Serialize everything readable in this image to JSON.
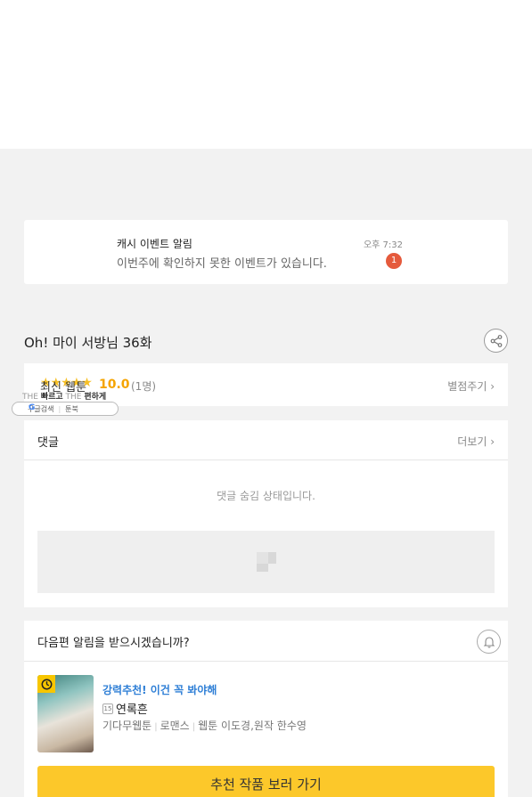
{
  "notification": {
    "title": "캐시 이벤트 알림",
    "message": "이번주에 확인하지 못한 이벤트가 있습니다.",
    "time": "오후 7:32",
    "badge_count": "1"
  },
  "episode": {
    "title": "Oh! 마이 서방님 36화"
  },
  "rating": {
    "label": "최신 웹툰",
    "stars": "★★★★★",
    "score": "10.0",
    "count": "(1명)",
    "rate_link": "별점주기 ›",
    "star_color": "#f5a400"
  },
  "promo": {
    "the1": "THE",
    "fast": "빠르고",
    "the2": "THE",
    "easy": "편하게",
    "g": "G",
    "google": "구글검색",
    "toonbook": "툰북"
  },
  "comments": {
    "title": "댓글",
    "more": "더보기 ›",
    "hidden_msg": "댓글 숨김 상태입니다."
  },
  "next_episode": {
    "question": "다음편 알림을 받으시겠습니까?"
  },
  "recommendation": {
    "label": "강력추천! 이건 꼭 봐야해",
    "age_badge": "15",
    "title": "연록흔",
    "genre1": "기다무웹툰",
    "genre2": "로맨스",
    "credits": "웹툰 이도경,원작 한수영",
    "accent_color": "#2f7fd6"
  },
  "cta": {
    "label": "추천 작품 보러 가기",
    "color": "#fcc82a"
  }
}
